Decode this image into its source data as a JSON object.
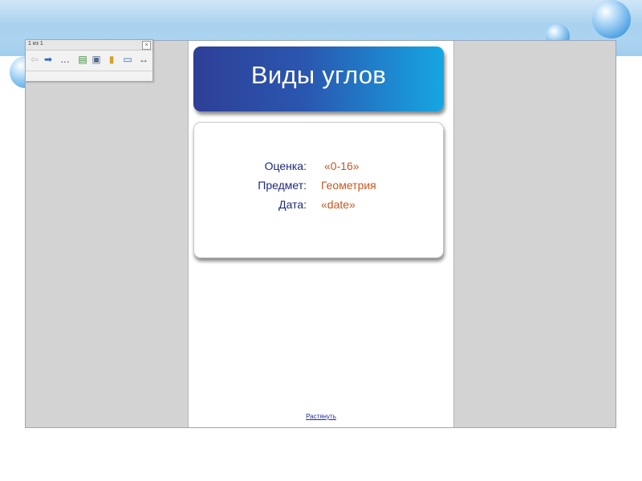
{
  "toolbar": {
    "page_counter": "1 из 1",
    "close_glyph": "×",
    "tools": [
      {
        "name": "back-arrow-icon",
        "glyph": "⇦",
        "color": "#bdbdbd"
      },
      {
        "name": "forward-arrow-icon",
        "glyph": "➡",
        "color": "#2f66c9"
      },
      {
        "name": "more-icon",
        "glyph": "…",
        "color": "#222222"
      },
      {
        "name": "insert-page-icon",
        "glyph": "▤",
        "color": "#3c8d3c"
      },
      {
        "name": "page-settings-icon",
        "glyph": "▣",
        "color": "#556b8a"
      },
      {
        "name": "clipboard-icon",
        "glyph": "▮",
        "color": "#d7a021"
      },
      {
        "name": "display-icon",
        "glyph": "▭",
        "color": "#2a6fb0"
      },
      {
        "name": "collapse-icon",
        "glyph": "↔",
        "color": "#555555"
      }
    ]
  },
  "page": {
    "title": "Виды углов",
    "fields": [
      {
        "label": "Оценка:",
        "value": "«0-16»"
      },
      {
        "label": "Предмет:",
        "value": "Геометрия"
      },
      {
        "label": "Дата:",
        "value": "«date»"
      }
    ],
    "expand_link": "Растянуть"
  },
  "colors": {
    "label": "#1f2a7a",
    "value": "#c8561e",
    "banner_start": "#2e3f97",
    "banner_end": "#16a6e3"
  }
}
